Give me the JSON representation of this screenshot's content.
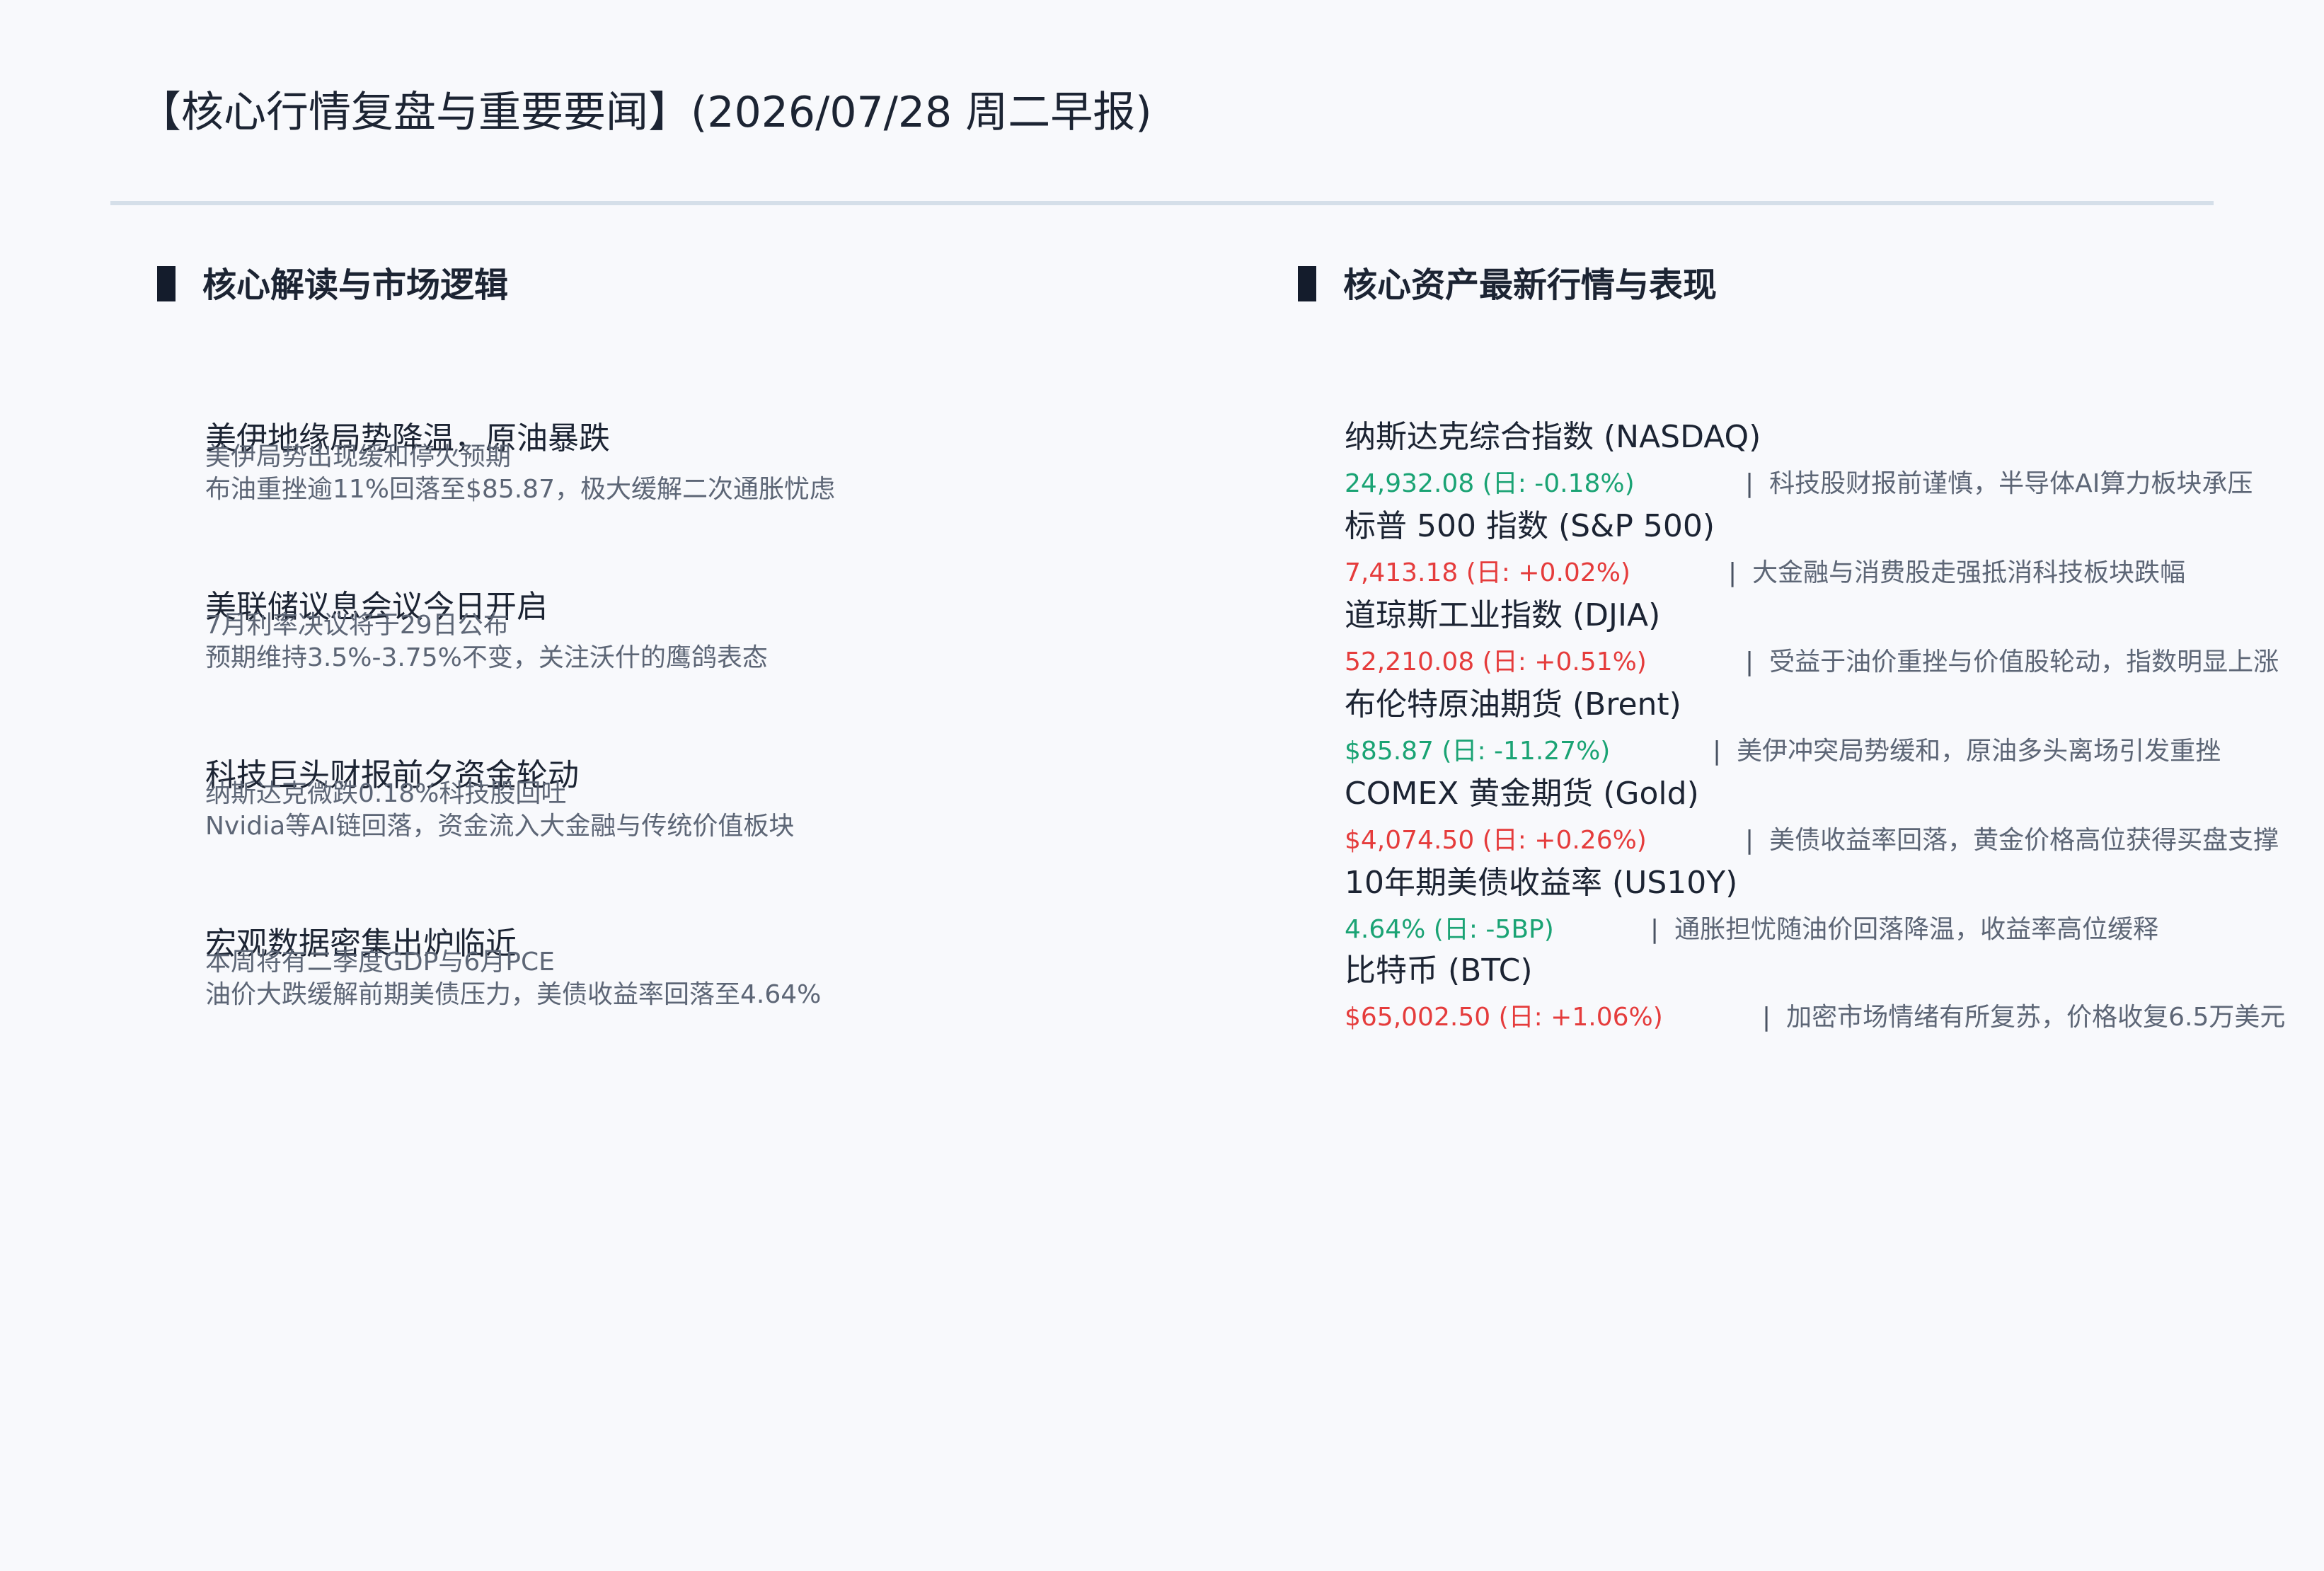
{
  "page_title": "【核心行情复盘与重要要闻】(2026/07/28 周二早报)",
  "sections": {
    "left_heading": "核心解读与市场逻辑",
    "right_heading": "核心资产最新行情与表现"
  },
  "news": [
    {
      "title": "美伊地缘局势降温，原油暴跌",
      "subtitle": "美伊局势出现缓和停火预期",
      "detail": "布油重挫逾11%回落至$85.87，极大缓解二次通胀忧虑"
    },
    {
      "title": "美联储议息会议今日开启",
      "subtitle": "7月利率决议将于29日公布",
      "detail": "预期维持3.5%-3.75%不变，关注沃什的鹰鸽表态"
    },
    {
      "title": "科技巨头财报前夕资金轮动",
      "subtitle": "纳斯达克微跌0.18%科技股回吐",
      "detail": "Nvidia等AI链回落，资金流入大金融与传统价值板块"
    },
    {
      "title": "宏观数据密集出炉临近",
      "subtitle": "本周将有二季度GDP与6月PCE",
      "detail": "油价大跌缓解前期美债压力，美债收益率回落至4.64%"
    }
  ],
  "assets": [
    {
      "name": "纳斯达克综合指数 (NASDAQ)",
      "price": "24,932.08 (日: -0.18%)",
      "direction": "down",
      "separator": "|",
      "note": "科技股财报前谨慎，半导体AI算力板块承压"
    },
    {
      "name": "标普 500 指数 (S&P 500)",
      "price": "7,413.18 (日: +0.02%)",
      "direction": "up",
      "separator": "|",
      "note": "大金融与消费股走强抵消科技板块跌幅"
    },
    {
      "name": "道琼斯工业指数 (DJIA)",
      "price": "52,210.08 (日: +0.51%)",
      "direction": "up",
      "separator": "|",
      "note": "受益于油价重挫与价值股轮动，指数明显上涨"
    },
    {
      "name": "布伦特原油期货 (Brent)",
      "price": "$85.87 (日: -11.27%)",
      "direction": "down",
      "separator": "|",
      "note": "美伊冲突局势缓和，原油多头离场引发重挫"
    },
    {
      "name": "COMEX 黄金期货 (Gold)",
      "price": "$4,074.50 (日: +0.26%)",
      "direction": "up",
      "separator": "|",
      "note": "美债收益率回落，黄金价格高位获得买盘支撑"
    },
    {
      "name": "10年期美债收益率 (US10Y)",
      "price": "4.64% (日: -5BP)",
      "direction": "down",
      "separator": "|",
      "note": "通胀担忧随油价回落降温，收益率高位缓释"
    },
    {
      "name": "比特币 (BTC)",
      "price": "$65,002.50 (日: +1.06%)",
      "direction": "up",
      "separator": "|",
      "note": "加密市场情绪有所复苏，价格收复6.5万美元"
    }
  ],
  "colors": {
    "down": "#1aa374",
    "up": "#e53c3c",
    "heading_bar": "#141c2c",
    "divider": "#d5dfe9"
  }
}
